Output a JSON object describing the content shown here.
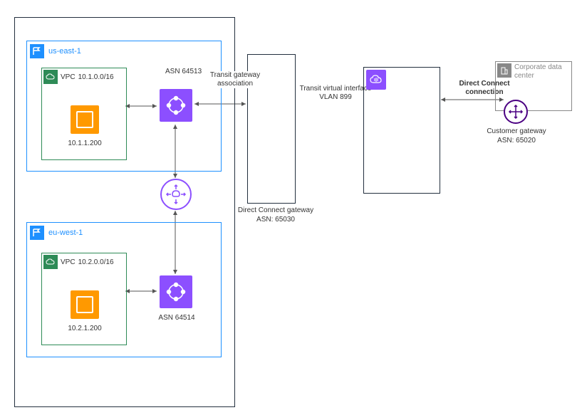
{
  "regions": {
    "group_label": "",
    "us_east_1": {
      "name": "us-east-1",
      "vpc": {
        "label": "VPC",
        "cidr": "10.1.0.0/16",
        "instance_ip": "10.1.1.200"
      },
      "tgw_asn": "ASN 64513"
    },
    "eu_west_1": {
      "name": "eu-west-1",
      "vpc": {
        "label": "VPC",
        "cidr": "10.2.0.0/16",
        "instance_ip": "10.2.1.200"
      },
      "tgw_asn": "ASN 64514"
    }
  },
  "dx_gateway": {
    "label": "Direct Connect gateway",
    "asn": "ASN: 65030"
  },
  "connections": {
    "tgw_association": "Transit gateway association",
    "tvi": "Transit virtual interface VLAN 899",
    "dx_conn": "Direct Connect connection"
  },
  "customer": {
    "cgw_label": "Customer gateway",
    "cgw_asn": "ASN: 65020",
    "corp_label": "Corporate data center"
  }
}
